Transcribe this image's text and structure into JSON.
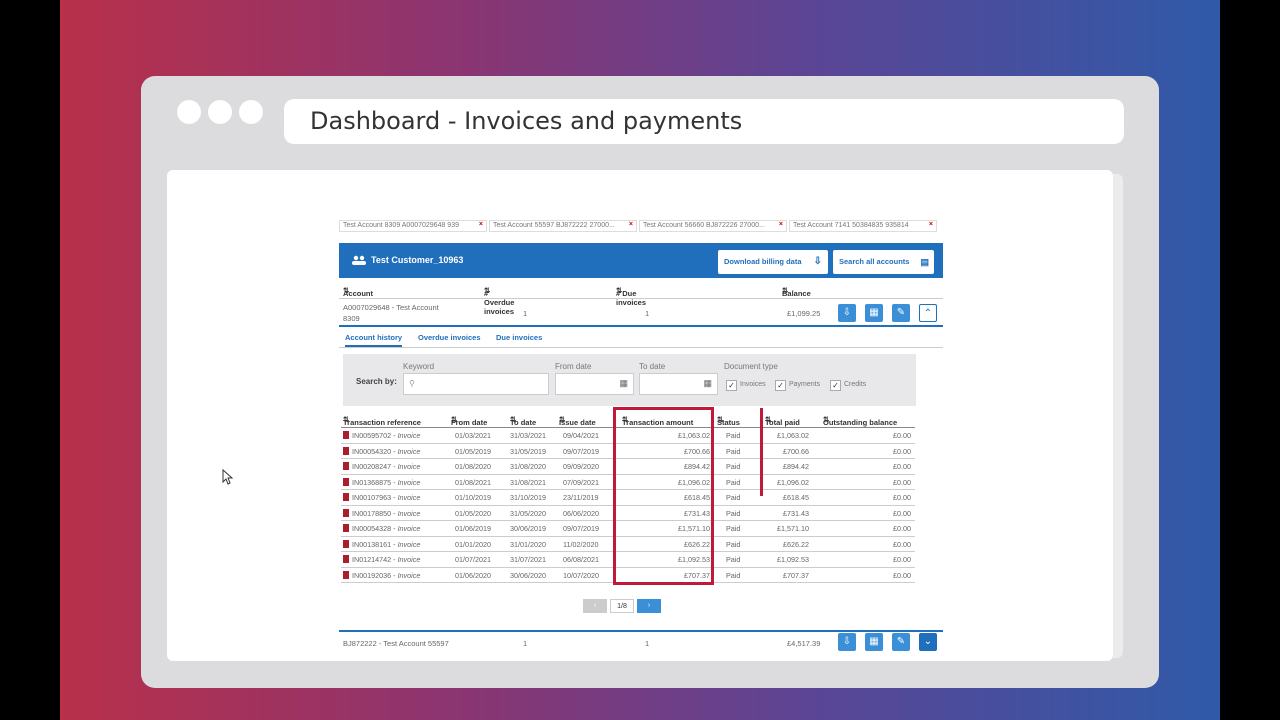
{
  "window": {
    "title": "Dashboard - Invoices and payments"
  },
  "chips": [
    {
      "label": "Test Account 8309 A0007029648 939"
    },
    {
      "label": "Test Account 55597 BJ872222 27000..."
    },
    {
      "label": "Test Account 56660 BJ872226 27000..."
    },
    {
      "label": "Test Account 7141 50384835 935814"
    }
  ],
  "customer": {
    "name": "Test Customer_10963",
    "download_label": "Download billing data",
    "search_label": "Search all accounts"
  },
  "accounts": {
    "headers": {
      "account": "Account",
      "overdue": "# Overdue invoices",
      "due": "# Due invoices",
      "balance": "Balance"
    },
    "row1": {
      "account": "A0007029648 - Test Account 8309",
      "overdue": "1",
      "due": "1",
      "balance": "£1,099.25"
    },
    "row2": {
      "account": "BJ872222 - Test Account 55597",
      "overdue": "1",
      "due": "1",
      "balance": "£4,517.39"
    }
  },
  "tabs": {
    "history": "Account history",
    "overdue": "Overdue invoices",
    "due": "Due invoices"
  },
  "filter": {
    "search_by": "Search by:",
    "keyword": "Keyword",
    "from_date": "From date",
    "to_date": "To date",
    "doc_type": "Document type",
    "invoices": "Invoices",
    "payments": "Payments",
    "credits": "Credits"
  },
  "transactions": {
    "headers": {
      "ref": "Transaction reference",
      "from": "From date",
      "to": "To date",
      "issue": "Issue date",
      "amount": "Transaction amount",
      "status": "Status",
      "paid": "Total paid",
      "outstanding": "Outstanding balance"
    },
    "rows": [
      {
        "ref": "IN00595702",
        "type": "Invoice",
        "from": "01/03/2021",
        "to": "31/03/2021",
        "issue": "09/04/2021",
        "amount": "£1,063.02",
        "status": "Paid",
        "paid": "£1,063.02",
        "outstanding": "£0.00"
      },
      {
        "ref": "IN00054320",
        "type": "Invoice",
        "from": "01/05/2019",
        "to": "31/05/2019",
        "issue": "09/07/2019",
        "amount": "£700.66",
        "status": "Paid",
        "paid": "£700.66",
        "outstanding": "£0.00"
      },
      {
        "ref": "IN00208247",
        "type": "Invoice",
        "from": "01/08/2020",
        "to": "31/08/2020",
        "issue": "09/09/2020",
        "amount": "£894.42",
        "status": "Paid",
        "paid": "£894.42",
        "outstanding": "£0.00"
      },
      {
        "ref": "IN01368875",
        "type": "Invoice",
        "from": "01/08/2021",
        "to": "31/08/2021",
        "issue": "07/09/2021",
        "amount": "£1,096.02",
        "status": "Paid",
        "paid": "£1,096.02",
        "outstanding": "£0.00"
      },
      {
        "ref": "IN00107963",
        "type": "Invoice",
        "from": "01/10/2019",
        "to": "31/10/2019",
        "issue": "23/11/2019",
        "amount": "£618.45",
        "status": "Paid",
        "paid": "£618.45",
        "outstanding": "£0.00"
      },
      {
        "ref": "IN00178850",
        "type": "Invoice",
        "from": "01/05/2020",
        "to": "31/05/2020",
        "issue": "06/06/2020",
        "amount": "£731.43",
        "status": "Paid",
        "paid": "£731.43",
        "outstanding": "£0.00"
      },
      {
        "ref": "IN00054328",
        "type": "Invoice",
        "from": "01/06/2019",
        "to": "30/06/2019",
        "issue": "09/07/2019",
        "amount": "£1,571.10",
        "status": "Paid",
        "paid": "£1,571.10",
        "outstanding": "£0.00"
      },
      {
        "ref": "IN00138161",
        "type": "Invoice",
        "from": "01/01/2020",
        "to": "31/01/2020",
        "issue": "11/02/2020",
        "amount": "£626.22",
        "status": "Paid",
        "paid": "£626.22",
        "outstanding": "£0.00"
      },
      {
        "ref": "IN01214742",
        "type": "Invoice",
        "from": "01/07/2021",
        "to": "31/07/2021",
        "issue": "06/08/2021",
        "amount": "£1,092.53",
        "status": "Paid",
        "paid": "£1,092.53",
        "outstanding": "£0.00"
      },
      {
        "ref": "IN00192036",
        "type": "Invoice",
        "from": "01/06/2020",
        "to": "30/06/2020",
        "issue": "10/07/2020",
        "amount": "£707.37",
        "status": "Paid",
        "paid": "£707.37",
        "outstanding": "£0.00"
      }
    ]
  },
  "pager": {
    "page": "1/8",
    "prev": "‹",
    "next": "›"
  },
  "colors": {
    "primary": "#1f6fbd",
    "highlight": "#c2183a",
    "pdf": "#a8202e"
  }
}
